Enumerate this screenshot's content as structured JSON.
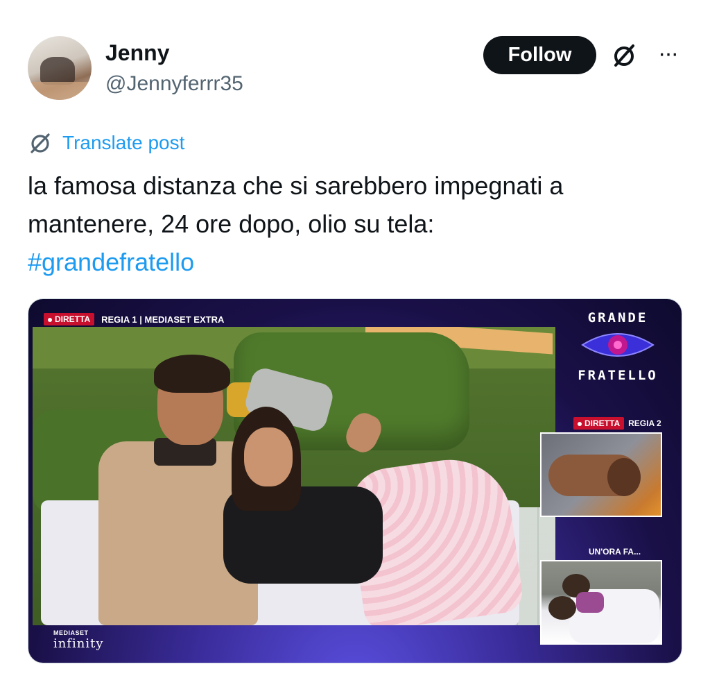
{
  "author": {
    "name": "Jenny",
    "handle": "@Jennyferrr35"
  },
  "actions": {
    "follow_label": "Follow",
    "grok_icon": "grok-icon",
    "more_label": "···"
  },
  "translate": {
    "label": "Translate post",
    "icon": "grok-icon"
  },
  "post": {
    "text": "la famosa distanza che si sarebbero impegnati a mantenere, 24 ore dopo, olio su tela:",
    "hashtag": "#grandefratello"
  },
  "media": {
    "live_badge": "DIRETTA",
    "regia_main": "REGIA 1 | MEDIASET EXTRA",
    "logo_top": "GRANDE",
    "logo_bottom": "FRATELLO",
    "side_live_badge": "DIRETTA",
    "side_regia": "REGIA 2",
    "hour_ago": "UN'ORA FA...",
    "brand_small": "MEDIASET",
    "brand_large": "infinity"
  },
  "colors": {
    "accent": "#1d9bf0",
    "text": "#0f1419",
    "secondary": "#536471",
    "live_red": "#c8102e"
  }
}
